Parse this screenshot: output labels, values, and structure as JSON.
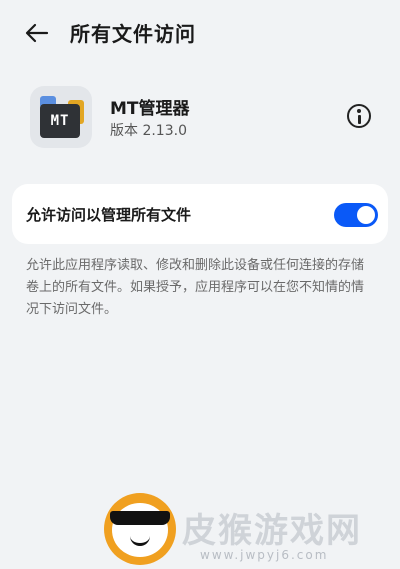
{
  "header": {
    "title": "所有文件访问"
  },
  "app": {
    "name": "MT管理器",
    "version": "版本 2.13.0",
    "icon_text": "MT"
  },
  "permission": {
    "label": "允许访问以管理所有文件",
    "enabled": true
  },
  "description": "允许此应用程序读取、修改和删除此设备或任何连接的存储卷上的所有文件。如果授予，应用程序可以在您不知情的情况下访问文件。",
  "watermark": {
    "title": "皮猴游戏网",
    "url": "www.jwpyj6.com"
  },
  "colors": {
    "accent": "#0a59f7",
    "background": "#f1f3f5",
    "card": "#ffffff"
  },
  "icons": {
    "back": "arrow-left-icon",
    "info": "info-icon"
  }
}
